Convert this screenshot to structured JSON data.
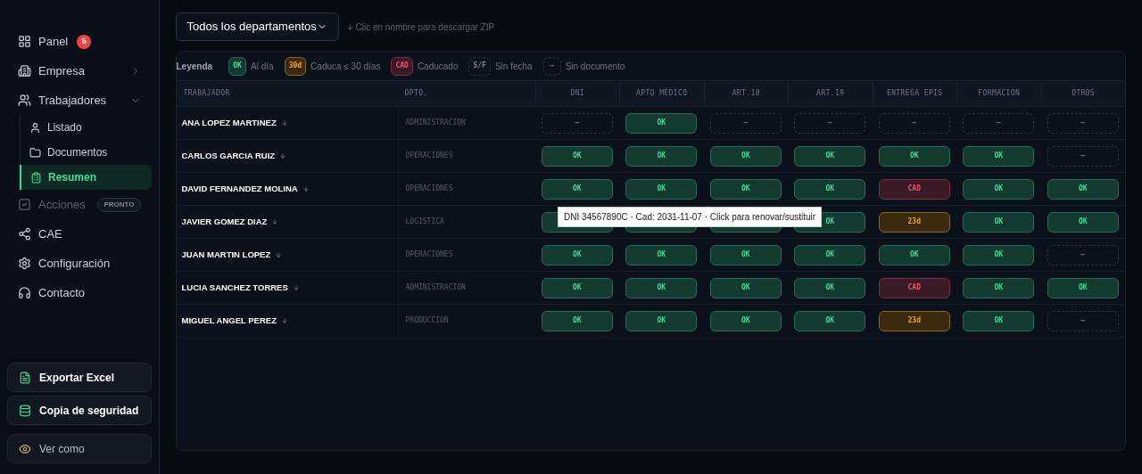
{
  "sidebar": {
    "items": [
      {
        "label": "Panel",
        "badge": "5",
        "selected": false,
        "disabled": false
      },
      {
        "label": "Empresa",
        "selected": false,
        "disabled": false,
        "expanded": false
      },
      {
        "label": "Trabajadores",
        "selected": false,
        "disabled": false,
        "expanded": true,
        "children": [
          {
            "label": "Listado",
            "selected": false
          },
          {
            "label": "Documentos",
            "selected": false
          },
          {
            "label": "Resumen",
            "selected": true
          }
        ]
      },
      {
        "label": "Acciones",
        "tag": "PRONTO",
        "selected": false,
        "disabled": true
      },
      {
        "label": "CAE",
        "selected": false,
        "disabled": false
      },
      {
        "label": "Configuración",
        "selected": false,
        "disabled": false
      },
      {
        "label": "Contacto",
        "selected": false,
        "disabled": false
      }
    ],
    "actions": [
      "Exportar Excel",
      "Copia de seguridad",
      "Ver como"
    ]
  },
  "filter": {
    "value": "Todos los departamentos"
  },
  "hint": "Clic en nombre para descargar ZIP",
  "legend": {
    "title": "Leyenda",
    "items": [
      {
        "kind": "ok",
        "code": "OK",
        "label": "Al día"
      },
      {
        "kind": "expiring",
        "code": "30d",
        "label": "Caduca ≤ 30 días"
      },
      {
        "kind": "expired",
        "code": "CAD",
        "label": "Caducado"
      },
      {
        "kind": "nodate",
        "code": "S/F",
        "label": "Sin fecha"
      },
      {
        "kind": "missing",
        "code": "–",
        "label": "Sin documento"
      }
    ]
  },
  "table": {
    "columns": [
      "TRABAJADOR",
      "DPTO.",
      "DNI",
      "APTO MÉDICO",
      "ART.18",
      "ART.19",
      "ENTREGA EPIS",
      "FORMACIÓN",
      "OTROS"
    ],
    "rows": [
      {
        "cells": [
          {
            "kind": "name",
            "text": "ANA LOPEZ MARTINEZ"
          },
          {
            "kind": "dept",
            "text": "ADMINISTRACION"
          },
          {
            "kind": "missing",
            "text": "–"
          },
          {
            "kind": "ok",
            "text": "OK"
          },
          {
            "kind": "missing",
            "text": "–"
          },
          {
            "kind": "missing",
            "text": "–"
          },
          {
            "kind": "missing",
            "text": "–"
          },
          {
            "kind": "missing",
            "text": "–"
          },
          {
            "kind": "missing",
            "text": "–"
          }
        ]
      },
      {
        "cells": [
          {
            "kind": "name",
            "text": "CARLOS GARCIA RUIZ"
          },
          {
            "kind": "dept",
            "text": "OPERACIONES"
          },
          {
            "kind": "ok",
            "text": "OK"
          },
          {
            "kind": "ok",
            "text": "OK"
          },
          {
            "kind": "ok",
            "text": "OK"
          },
          {
            "kind": "ok",
            "text": "OK"
          },
          {
            "kind": "ok",
            "text": "OK"
          },
          {
            "kind": "ok",
            "text": "OK"
          },
          {
            "kind": "missing",
            "text": "–"
          }
        ]
      },
      {
        "cells": [
          {
            "kind": "name",
            "text": "DAVID FERNANDEZ MOLINA"
          },
          {
            "kind": "dept",
            "text": "OPERACIONES"
          },
          {
            "kind": "ok",
            "text": "OK"
          },
          {
            "kind": "ok",
            "text": "OK"
          },
          {
            "kind": "ok",
            "text": "OK"
          },
          {
            "kind": "ok",
            "text": "OK"
          },
          {
            "kind": "expired",
            "text": "CAD"
          },
          {
            "kind": "ok",
            "text": "OK"
          },
          {
            "kind": "ok",
            "text": "OK"
          }
        ]
      },
      {
        "cells": [
          {
            "kind": "name",
            "text": "JAVIER GOMEZ DIAZ"
          },
          {
            "kind": "dept",
            "text": "LOGISTICA"
          },
          {
            "kind": "ok"
          },
          {
            "kind": "ok"
          },
          {
            "kind": "ok"
          },
          {
            "kind": "ok",
            "text": "OK"
          },
          {
            "kind": "expiring",
            "text": "23d"
          },
          {
            "kind": "ok",
            "text": "OK"
          },
          {
            "kind": "ok",
            "text": "OK"
          }
        ]
      },
      {
        "cells": [
          {
            "kind": "name",
            "text": "JUAN MARTIN LOPEZ"
          },
          {
            "kind": "dept",
            "text": "OPERACIONES"
          },
          {
            "kind": "ok",
            "text": "OK"
          },
          {
            "kind": "ok",
            "text": "OK"
          },
          {
            "kind": "ok",
            "text": "OK"
          },
          {
            "kind": "ok",
            "text": "OK"
          },
          {
            "kind": "ok",
            "text": "OK"
          },
          {
            "kind": "ok",
            "text": "OK"
          },
          {
            "kind": "missing",
            "text": "–"
          }
        ]
      },
      {
        "cells": [
          {
            "kind": "name",
            "text": "LUCIA SANCHEZ TORRES"
          },
          {
            "kind": "dept",
            "text": "ADMINISTRACION"
          },
          {
            "kind": "ok",
            "text": "OK"
          },
          {
            "kind": "ok",
            "text": "OK"
          },
          {
            "kind": "ok",
            "text": "OK"
          },
          {
            "kind": "ok",
            "text": "OK"
          },
          {
            "kind": "expired",
            "text": "CAD"
          },
          {
            "kind": "ok",
            "text": "OK"
          },
          {
            "kind": "ok",
            "text": "OK"
          }
        ]
      },
      {
        "cells": [
          {
            "kind": "name",
            "text": "MIGUEL ANGEL PEREZ"
          },
          {
            "kind": "dept",
            "text": "PRODUCCION"
          },
          {
            "kind": "ok",
            "text": "OK"
          },
          {
            "kind": "ok",
            "text": "OK"
          },
          {
            "kind": "ok",
            "text": "OK"
          },
          {
            "kind": "ok",
            "text": "OK"
          },
          {
            "kind": "expiring",
            "text": "23d"
          },
          {
            "kind": "ok",
            "text": "OK"
          },
          {
            "kind": "missing",
            "text": "–"
          }
        ]
      }
    ]
  },
  "tooltip": "DNI 34567890C · Cad: 2031-11-07 · Click para renovar/sustituir"
}
